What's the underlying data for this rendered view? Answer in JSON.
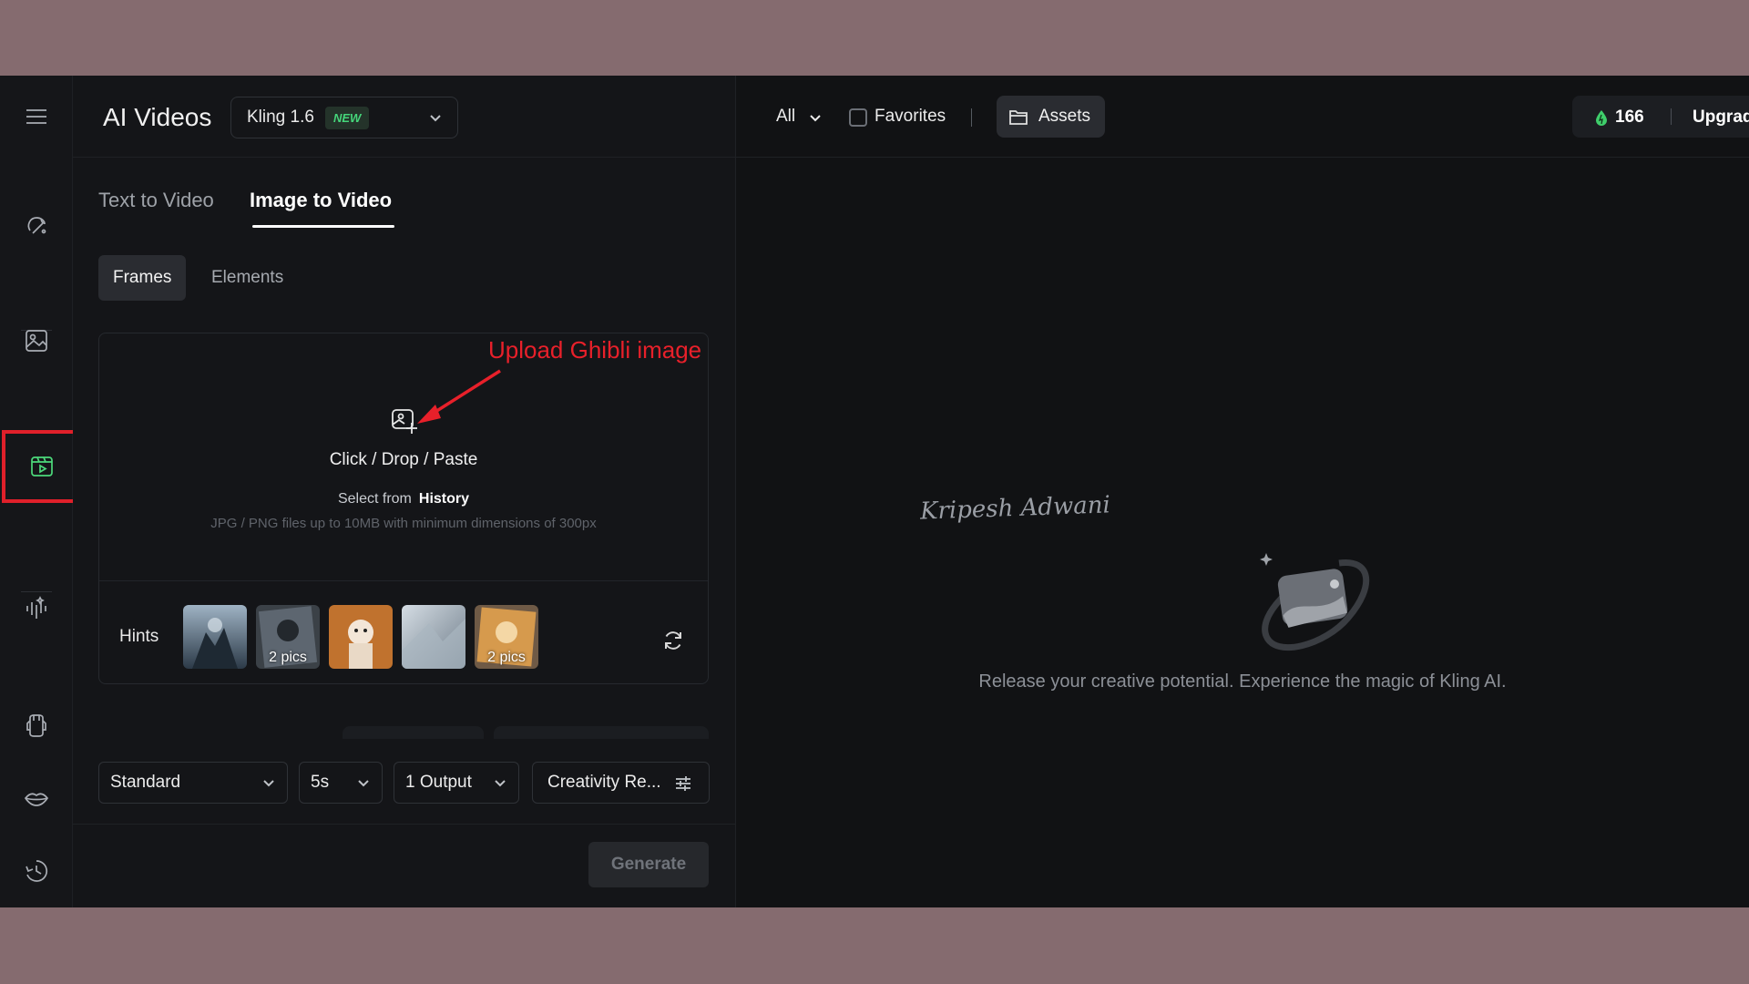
{
  "header": {
    "title": "AI Videos",
    "model": {
      "name": "Kling 1.6",
      "badge": "NEW"
    }
  },
  "tabs": [
    {
      "label": "Text to Video",
      "active": false
    },
    {
      "label": "Image to Video",
      "active": true
    }
  ],
  "subtabs": [
    {
      "label": "Frames",
      "active": true
    },
    {
      "label": "Elements",
      "active": false
    }
  ],
  "upload": {
    "cta": "Click / Drop / Paste",
    "history_prefix": "Select from",
    "history_link": "History",
    "rules": "JPG / PNG files up to 10MB with minimum dimensions of 300px"
  },
  "annotation": {
    "text": "Upload Ghibli image",
    "color": "#e8202a"
  },
  "hints": {
    "label": "Hints",
    "items": [
      {
        "count": ""
      },
      {
        "count": "2 pics"
      },
      {
        "count": ""
      },
      {
        "count": ""
      },
      {
        "count": "2 pics"
      }
    ]
  },
  "settings": {
    "mode": "Standard",
    "duration": "5s",
    "outputs": "1 Output",
    "creativity": "Creativity Re..."
  },
  "generate": {
    "label": "Generate",
    "enabled": false
  },
  "topbar": {
    "filter": "All",
    "favorites_label": "Favorites",
    "favorites_checked": false,
    "assets_label": "Assets",
    "credits": "166",
    "upgrade_label": "Upgrade"
  },
  "watermark": {
    "signature": "Kripesh Adwani"
  },
  "empty_state": {
    "message": "Release your creative potential. Experience the magic of Kling AI."
  },
  "rail": {
    "items": [
      "menu-icon",
      "magic-brush-icon",
      "image-icon",
      "video-icon",
      "audio-wave-icon",
      "shirt-icon",
      "lips-icon",
      "history-icon"
    ],
    "active": "video-icon",
    "highlight_color": "#e0202a",
    "accent": "#4cd97b"
  }
}
